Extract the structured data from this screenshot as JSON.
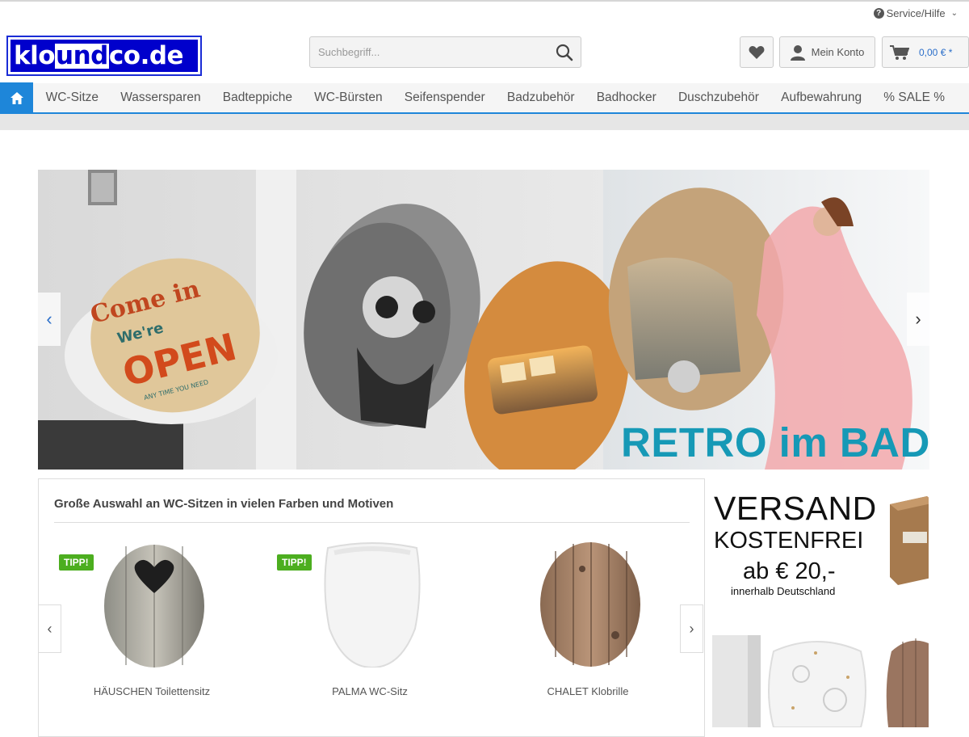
{
  "header": {
    "service_label": "Service/Hilfe",
    "logo": {
      "part1": "klo",
      "part2": "und",
      "part3": "co.de"
    },
    "search_placeholder": "Suchbegriff...",
    "account_label": "Mein Konto",
    "cart_amount": "0,00 € *"
  },
  "nav": {
    "items": [
      "WC-Sitze",
      "Wassersparen",
      "Badteppiche",
      "WC-Bürsten",
      "Seifenspender",
      "Badzubehör",
      "Badhocker",
      "Duschzubehör",
      "Aufbewahrung",
      "% SALE %"
    ]
  },
  "hero": {
    "slide_text": "RETRO im BAD",
    "seat_text": {
      "line1": "Come in",
      "line2": "We're",
      "line3": "OPEN",
      "line4": "ANY TIME YOU NEED"
    }
  },
  "products": {
    "title": "Große Auswahl an WC-Sitzen in vielen Farben und Motiven",
    "items": [
      {
        "name": "HÄUSCHEN Toilettensitz",
        "tag": "TIPP!"
      },
      {
        "name": "PALMA WC-Sitz",
        "tag": "TIPP!"
      },
      {
        "name": "CHALET Klobrille",
        "tag": ""
      }
    ]
  },
  "promo": {
    "line1": "VERSAND",
    "line2": "KOSTENFREI",
    "line3": "ab € 20,-",
    "line4": "innerhalb Deutschland"
  },
  "colors": {
    "accent": "#1e86d9",
    "logo_blue": "#0000cc",
    "tip_green": "#4cae1f",
    "retro_teal": "#1699b6"
  }
}
